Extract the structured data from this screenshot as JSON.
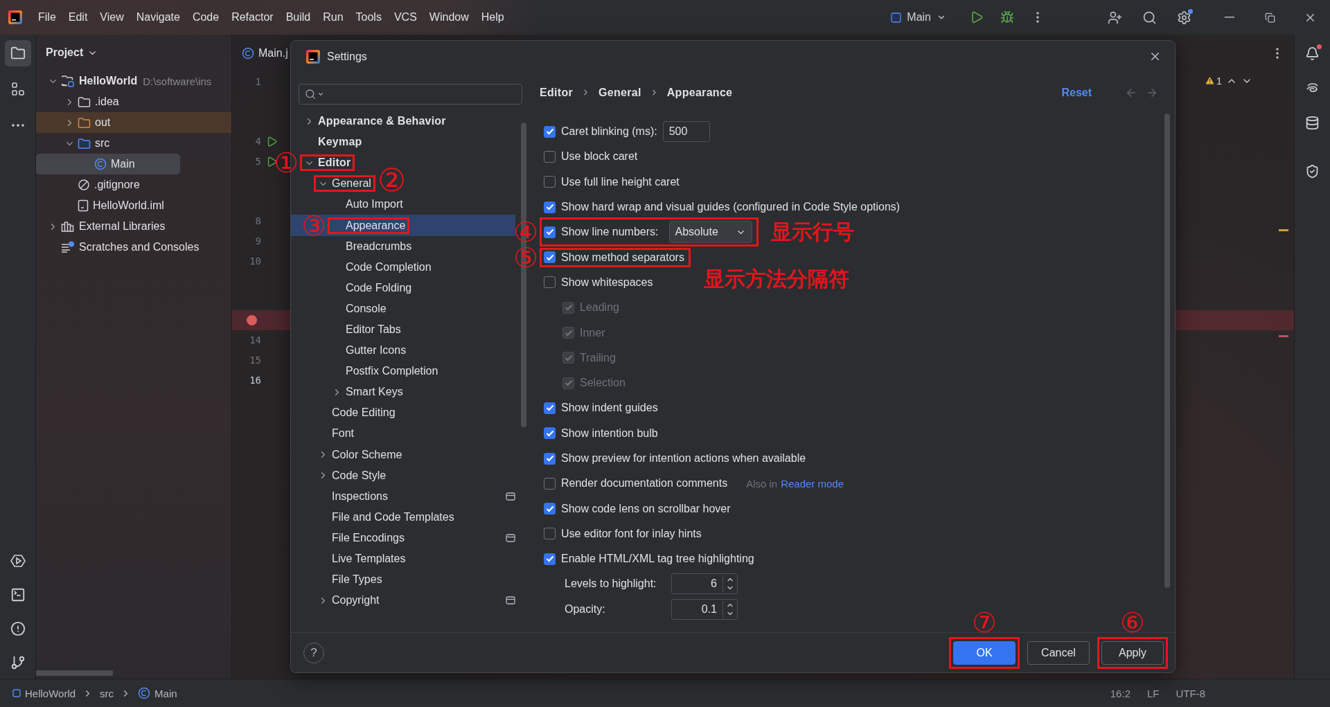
{
  "menu": [
    "File",
    "Edit",
    "View",
    "Navigate",
    "Code",
    "Refactor",
    "Build",
    "Run",
    "Tools",
    "VCS",
    "Window",
    "Help"
  ],
  "run_config": "Main",
  "left_toolbar": {
    "top": [
      {
        "selected": true
      },
      {
        "selected": false
      },
      {
        "selected": false
      }
    ],
    "bottom": [
      {
        "selected": false
      },
      {
        "selected": false
      },
      {
        "selected": false
      },
      {
        "selected": false
      }
    ]
  },
  "project": {
    "title": "Project",
    "tree": [
      {
        "label": "HelloWorld",
        "path": "D:\\software\\ins",
        "kind": "module",
        "expanded": true,
        "selected": false,
        "children": [
          {
            "label": ".idea",
            "kind": "folder",
            "expanded": false,
            "selected": false
          },
          {
            "label": "out",
            "kind": "excluded",
            "expanded": false,
            "selected": false
          },
          {
            "label": "src",
            "kind": "source",
            "expanded": true,
            "selected": false,
            "children": [
              {
                "label": "Main",
                "kind": "class",
                "selected": true
              }
            ]
          },
          {
            "label": ".gitignore",
            "kind": "ignore",
            "selected": false
          },
          {
            "label": "HelloWorld.iml",
            "kind": "file",
            "selected": false
          }
        ]
      },
      {
        "label": "External Libraries",
        "kind": "libraries",
        "expanded": false,
        "selected": false
      },
      {
        "label": "Scratches and Consoles",
        "kind": "scratches",
        "selected": false
      }
    ]
  },
  "editor": {
    "tab": "Main.j",
    "warnings": "1",
    "gutter": [
      {
        "kind": "line",
        "number": "1",
        "current": false
      },
      {
        "kind": "blank"
      },
      {
        "kind": "blank"
      },
      {
        "kind": "run",
        "number": "4",
        "current": false
      },
      {
        "kind": "run",
        "number": "5",
        "current": false
      },
      {
        "kind": "blank"
      },
      {
        "kind": "blank"
      },
      {
        "kind": "line",
        "number": "8",
        "current": false
      },
      {
        "kind": "line",
        "number": "9",
        "current": false
      },
      {
        "kind": "line",
        "number": "10",
        "current": false
      },
      {
        "kind": "blank"
      },
      {
        "kind": "blank"
      },
      {
        "kind": "breakpoint"
      },
      {
        "kind": "line",
        "number": "14",
        "current": false
      },
      {
        "kind": "line",
        "number": "15",
        "current": false
      },
      {
        "kind": "line",
        "number": "16",
        "current": true
      }
    ],
    "stripe_marks": [
      {
        "color": "#c9a23a"
      },
      {
        "color": "#b3536a"
      }
    ]
  },
  "right_toolbar": [
    {
      "badge": true
    },
    {
      "badge": false
    },
    {
      "badge": false
    },
    {
      "badge": false
    }
  ],
  "settings": {
    "title": "Settings",
    "tree": [
      {
        "label": "Appearance & Behavior",
        "expanded": false,
        "selected": false
      },
      {
        "label": "Keymap",
        "selected": false
      },
      {
        "label": "Editor",
        "expanded": true,
        "selected": false,
        "annotation": {
          "number": "①",
          "callout_after": false
        },
        "children": [
          {
            "label": "General",
            "expanded": true,
            "selected": false,
            "annotation": {
              "number": "②",
              "callout_after": true
            },
            "children": [
              {
                "label": "Auto Import",
                "selected": false
              },
              {
                "label": "Appearance",
                "selected": true,
                "annotation": {
                  "number": "③",
                  "callout_after": false
                }
              },
              {
                "label": "Breadcrumbs",
                "selected": false
              },
              {
                "label": "Code Completion",
                "selected": false
              },
              {
                "label": "Code Folding",
                "selected": false
              },
              {
                "label": "Console",
                "selected": false
              },
              {
                "label": "Editor Tabs",
                "selected": false
              },
              {
                "label": "Gutter Icons",
                "selected": false
              },
              {
                "label": "Postfix Completion",
                "selected": false
              },
              {
                "label": "Smart Keys",
                "expanded": false,
                "selected": false
              }
            ]
          },
          {
            "label": "Code Editing",
            "selected": false
          },
          {
            "label": "Font",
            "selected": false
          },
          {
            "label": "Color Scheme",
            "expanded": false,
            "selected": false
          },
          {
            "label": "Code Style",
            "expanded": false,
            "selected": false
          },
          {
            "label": "Inspections",
            "selected": false,
            "project_scope": true
          },
          {
            "label": "File and Code Templates",
            "selected": false
          },
          {
            "label": "File Encodings",
            "selected": false,
            "project_scope": true
          },
          {
            "label": "Live Templates",
            "selected": false
          },
          {
            "label": "File Types",
            "selected": false
          },
          {
            "label": "Copyright",
            "expanded": false,
            "selected": false,
            "project_scope": true
          }
        ]
      }
    ],
    "breadcrumb": [
      "Editor",
      "General",
      "Appearance"
    ],
    "reset": "Reset",
    "options": [
      {
        "kind": "checkbox",
        "label": "Caret blinking (ms):",
        "checked": true,
        "disabled": false,
        "value": "500"
      },
      {
        "kind": "checkbox",
        "label": "Use block caret",
        "checked": false,
        "disabled": false
      },
      {
        "kind": "checkbox",
        "label": "Use full line height caret",
        "checked": false,
        "disabled": false
      },
      {
        "kind": "checkbox",
        "label": "Show hard wrap and visual guides (configured in Code Style options)",
        "checked": true,
        "disabled": false
      },
      {
        "kind": "checkbox",
        "label": "Show line numbers:",
        "checked": true,
        "disabled": false,
        "dropdown": "Absolute",
        "annotation": {
          "number": "④",
          "note": "显示行号",
          "note_below": false
        }
      },
      {
        "kind": "checkbox",
        "label": "Show method separators",
        "checked": true,
        "disabled": false,
        "annotation": {
          "number": "⑤",
          "note": "显示方法分隔符",
          "note_below": true
        }
      },
      {
        "kind": "checkbox",
        "label": "Show whitespaces",
        "checked": false,
        "disabled": false,
        "children": [
          {
            "kind": "checkbox",
            "label": "Leading",
            "checked": true,
            "disabled": true
          },
          {
            "kind": "checkbox",
            "label": "Inner",
            "checked": true,
            "disabled": true
          },
          {
            "kind": "checkbox",
            "label": "Trailing",
            "checked": true,
            "disabled": true
          },
          {
            "kind": "checkbox",
            "label": "Selection",
            "checked": true,
            "disabled": true
          }
        ]
      },
      {
        "kind": "checkbox",
        "label": "Show indent guides",
        "checked": true,
        "disabled": false
      },
      {
        "kind": "checkbox",
        "label": "Show intention bulb",
        "checked": true,
        "disabled": false
      },
      {
        "kind": "checkbox",
        "label": "Show preview for intention actions when available",
        "checked": true,
        "disabled": false
      },
      {
        "kind": "checkbox",
        "label": "Render documentation comments",
        "checked": false,
        "disabled": false,
        "hint": "Also in",
        "link": "Reader mode"
      },
      {
        "kind": "checkbox",
        "label": "Show code lens on scrollbar hover",
        "checked": true,
        "disabled": false
      },
      {
        "kind": "checkbox",
        "label": "Use editor font for inlay hints",
        "checked": false,
        "disabled": false
      },
      {
        "kind": "checkbox",
        "label": "Enable HTML/XML tag tree highlighting",
        "checked": true,
        "disabled": false,
        "children": [
          {
            "kind": "spinner",
            "label": "Levels to highlight:",
            "value": "6"
          },
          {
            "kind": "spinner",
            "label": "Opacity:",
            "value": "0.1"
          }
        ]
      }
    ],
    "help": "?",
    "buttons": [
      {
        "label": "OK",
        "kind": "primary",
        "annotation": {
          "number": "⑦"
        }
      },
      {
        "label": "Cancel",
        "kind": "secondary"
      },
      {
        "label": "Apply",
        "kind": "secondary",
        "annotation": {
          "number": "⑥"
        }
      }
    ]
  },
  "status_bar": {
    "breadcrumb": [
      {
        "label": "HelloWorld",
        "kind": "module"
      },
      {
        "label": "src",
        "kind": "folder"
      },
      {
        "label": "Main",
        "kind": "class"
      }
    ],
    "items": [
      "16:2",
      "LF",
      "UTF-8"
    ]
  }
}
